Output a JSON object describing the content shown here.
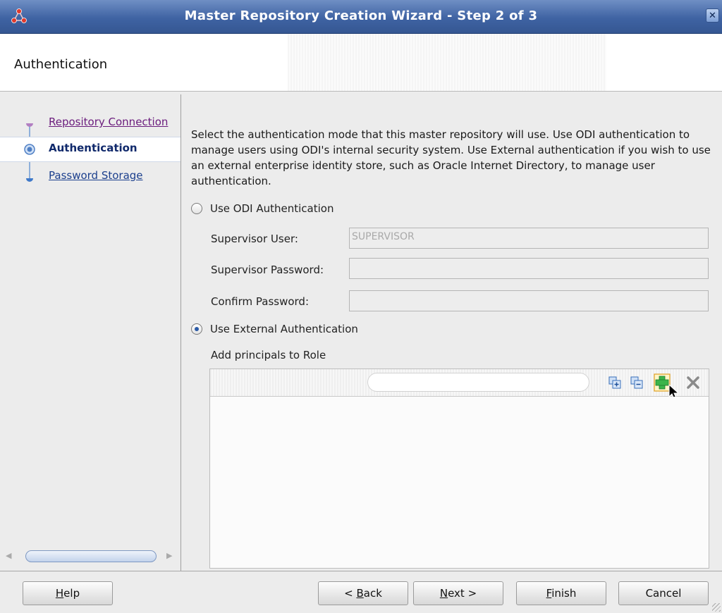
{
  "window": {
    "title": "Master Repository Creation Wizard - Step 2 of 3",
    "close_label": "✕"
  },
  "header": {
    "title": "Authentication"
  },
  "nav": {
    "items": [
      {
        "label": "Repository Connection",
        "state": "visited"
      },
      {
        "label": "Authentication",
        "state": "current"
      },
      {
        "label": "Password Storage",
        "state": "pending"
      }
    ],
    "scroll_left": "◀",
    "scroll_right": "▶"
  },
  "content": {
    "intro": "Select the authentication mode that this master repository will use. Use ODI authentication to manage users using ODI's internal security system. Use External authentication if you wish to use an external enterprise identity store, such as Oracle Internet Directory, to manage user authentication.",
    "odi_auth": {
      "label": "Use ODI Authentication",
      "selected": false,
      "supervisor_user_label": "Supervisor User:",
      "supervisor_user_value": "SUPERVISOR",
      "supervisor_password_label": "Supervisor Password:",
      "supervisor_password_value": "",
      "confirm_password_label": "Confirm Password:",
      "confirm_password_value": ""
    },
    "external_auth": {
      "label": "Use External Authentication",
      "selected": true,
      "principals_label": "Add principals to Role",
      "search_value": "",
      "toolbar_icons": [
        "expand-all-icon",
        "collapse-all-icon",
        "add-icon",
        "remove-icon"
      ]
    }
  },
  "footer": {
    "help": {
      "label": "Help",
      "mnemonic": "H"
    },
    "back": {
      "label": "< Back",
      "mnemonic": "B"
    },
    "next": {
      "label": "Next >",
      "mnemonic": "N"
    },
    "finish": {
      "label": "Finish",
      "mnemonic": "F"
    },
    "cancel": {
      "label": "Cancel"
    }
  },
  "colors": {
    "titlebar": "#3f63a3",
    "accent": "#2b5aa6",
    "visited_link": "#6a1b7c",
    "link": "#1b3f8d",
    "add_icon": "#3bb54a"
  }
}
